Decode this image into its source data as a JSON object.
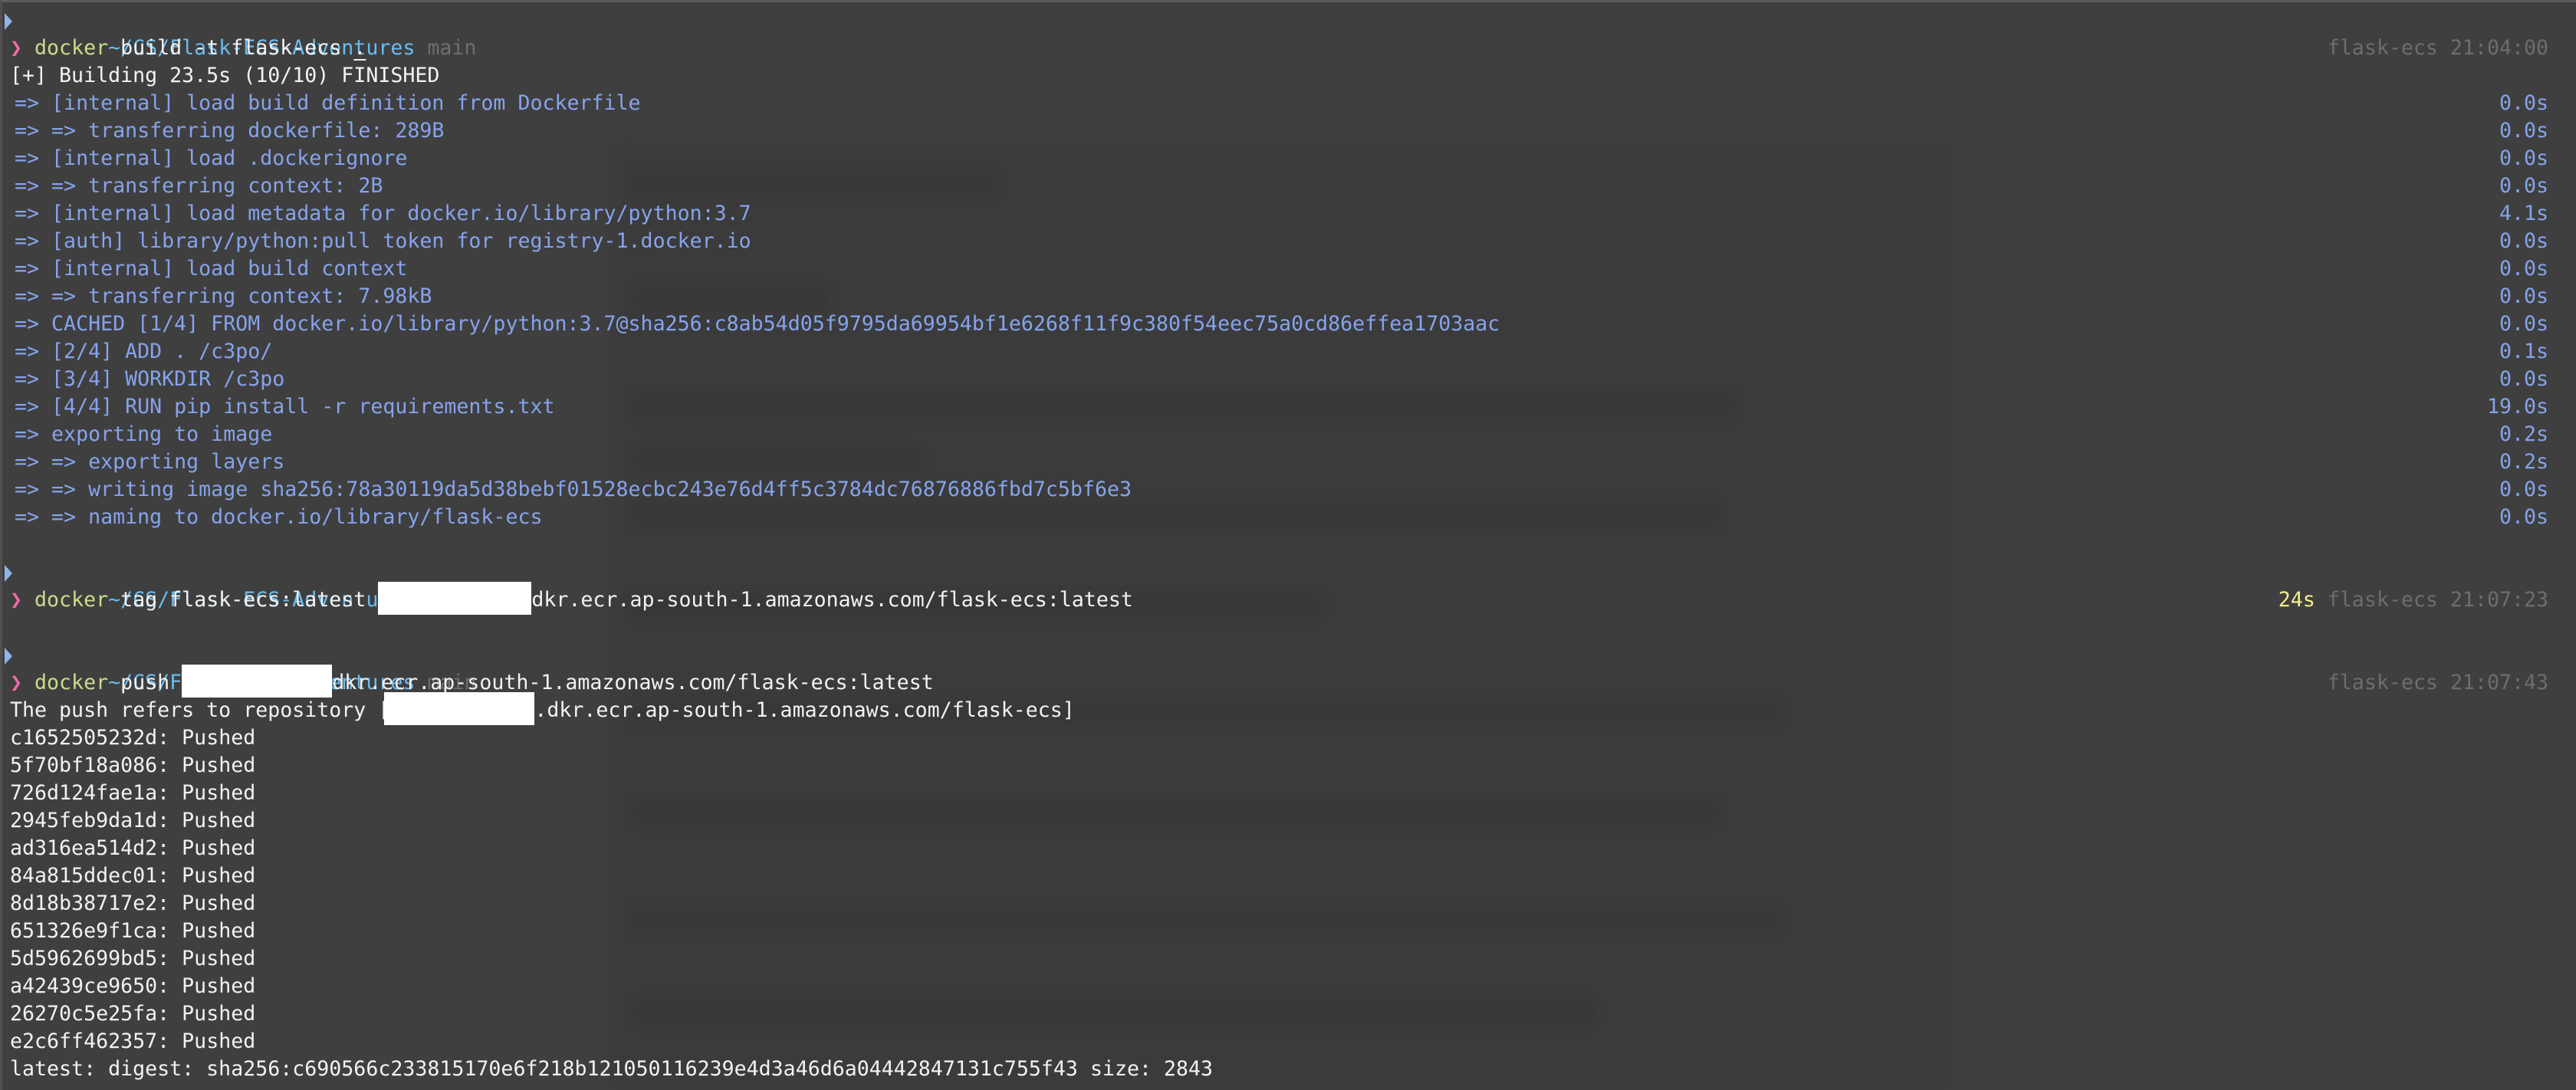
{
  "prompt": {
    "path": "~/CS/Flask-ECS-Adventures",
    "branch": "main",
    "chevron": "❯"
  },
  "sessions": [
    {
      "context": "flask-ecs",
      "time": "21:04:00",
      "command": "docker",
      "args_before": "build -t flask-ecs ",
      "args_underlined": ".",
      "header": "[+] Building 23.5s (10/10) FINISHED",
      "steps": [
        {
          "text": " => [internal] load build definition from Dockerfile",
          "duration": "0.0s"
        },
        {
          "text": " => => transferring dockerfile: 289B",
          "duration": "0.0s"
        },
        {
          "text": " => [internal] load .dockerignore",
          "duration": "0.0s"
        },
        {
          "text": " => => transferring context: 2B",
          "duration": "0.0s"
        },
        {
          "text": " => [internal] load metadata for docker.io/library/python:3.7",
          "duration": "4.1s"
        },
        {
          "text": " => [auth] library/python:pull token for registry-1.docker.io",
          "duration": "0.0s"
        },
        {
          "text": " => [internal] load build context",
          "duration": "0.0s"
        },
        {
          "text": " => => transferring context: 7.98kB",
          "duration": "0.0s"
        },
        {
          "text": " => CACHED [1/4] FROM docker.io/library/python:3.7@sha256:c8ab54d05f9795da69954bf1e6268f11f9c380f54eec75a0cd86effea1703aac",
          "duration": "0.0s"
        },
        {
          "text": " => [2/4] ADD . /c3po/",
          "duration": "0.1s"
        },
        {
          "text": " => [3/4] WORKDIR /c3po",
          "duration": "0.0s"
        },
        {
          "text": " => [4/4] RUN pip install -r requirements.txt",
          "duration": "19.0s"
        },
        {
          "text": " => exporting to image",
          "duration": "0.2s"
        },
        {
          "text": " => => exporting layers",
          "duration": "0.2s"
        },
        {
          "text": " => => writing image sha256:78a30119da5d38bebf01528ecbc243e76d4ff5c3784dc76876886fbd7c5bf6e3",
          "duration": "0.0s"
        },
        {
          "text": " => => naming to docker.io/library/flask-ecs",
          "duration": "0.0s"
        }
      ]
    },
    {
      "elapsed": "24s",
      "context": "flask-ecs",
      "time": "21:07:23",
      "command": "docker",
      "args_before": "tag flask-ecs:latest ",
      "args_after": "dkr.ecr.ap-south-1.amazonaws.com/flask-ecs:latest"
    },
    {
      "context": "flask-ecs",
      "time": "21:07:43",
      "command": "docker",
      "args_before": "push ",
      "args_after": "dkr.ecr.ap-south-1.amazonaws.com/flask-ecs:latest",
      "repo_prefix": "The push refers to repository [",
      "repo_suffix": ".dkr.ecr.ap-south-1.amazonaws.com/flask-ecs]",
      "layers": [
        {
          "id": "c1652505232d",
          "status": "Pushed"
        },
        {
          "id": "5f70bf18a086",
          "status": "Pushed"
        },
        {
          "id": "726d124fae1a",
          "status": "Pushed"
        },
        {
          "id": "2945feb9da1d",
          "status": "Pushed"
        },
        {
          "id": "ad316ea514d2",
          "status": "Pushed"
        },
        {
          "id": "84a815ddec01",
          "status": "Pushed"
        },
        {
          "id": "8d18b38717e2",
          "status": "Pushed"
        },
        {
          "id": "651326e9f1ca",
          "status": "Pushed"
        },
        {
          "id": "5d5962699bd5",
          "status": "Pushed"
        },
        {
          "id": "a42439ce9650",
          "status": "Pushed"
        },
        {
          "id": "26270c5e25fa",
          "status": "Pushed"
        },
        {
          "id": "e2c6ff462357",
          "status": "Pushed"
        }
      ],
      "digest_line": "latest: digest: sha256:c690566c233815170e6f218b121050116239e4d3a46d6a04442847131c755f43 size: 2843"
    }
  ],
  "colors": {
    "background": "#3f3f3f",
    "path": "#6bbcf0",
    "branch": "#6d6d6d",
    "chevron": "#ef6aa8",
    "command": "#c9dc8a",
    "build_step": "#86a3ec",
    "elapsed": "#f3ec8e",
    "redaction": "#ffffff"
  }
}
